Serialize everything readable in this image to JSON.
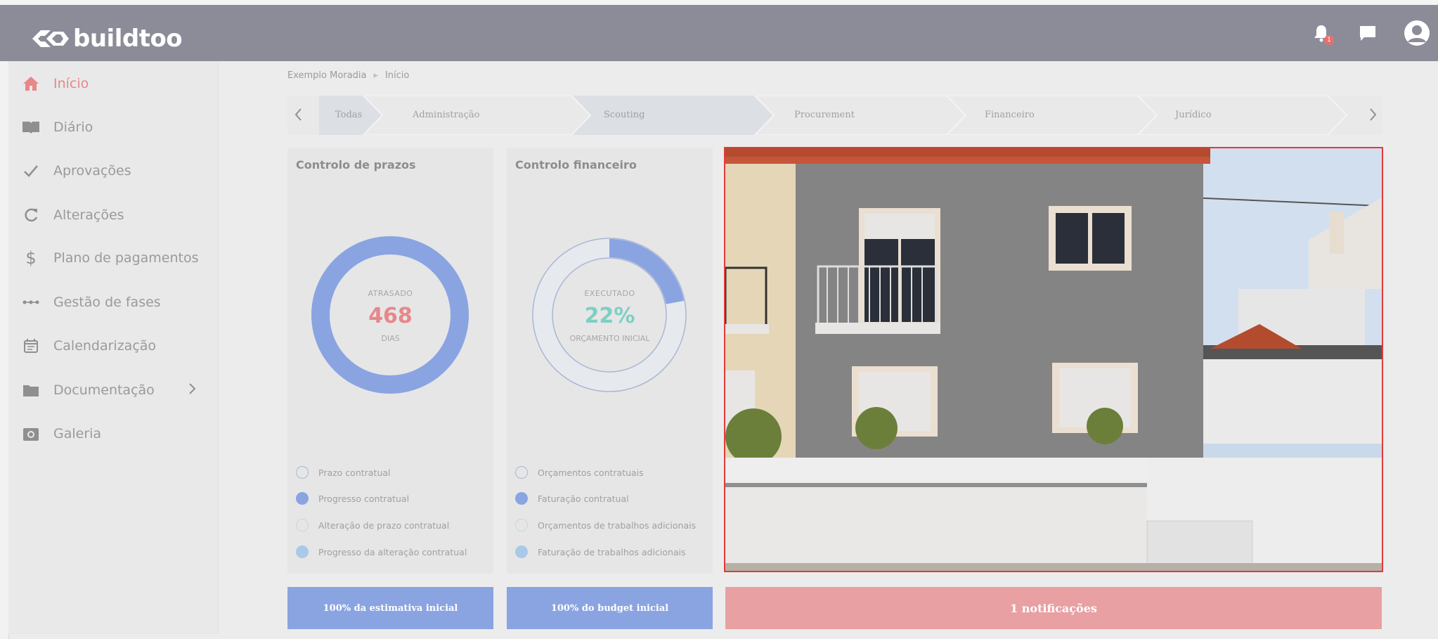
{
  "app": {
    "logo_text": "buildtoo",
    "notification_count": "1"
  },
  "sidebar": {
    "items": [
      {
        "label": "Início",
        "icon": "home-icon"
      },
      {
        "label": "Diário",
        "icon": "book-icon"
      },
      {
        "label": "Aprovações",
        "icon": "check-icon"
      },
      {
        "label": "Alterações",
        "icon": "refresh-icon"
      },
      {
        "label": "Plano de pagamentos",
        "icon": "dollar-icon"
      },
      {
        "label": "Gestão de fases",
        "icon": "phases-icon"
      },
      {
        "label": "Calendarização",
        "icon": "calendar-icon"
      },
      {
        "label": "Documentação",
        "icon": "folder-icon"
      },
      {
        "label": "Galeria",
        "icon": "camera-icon"
      }
    ]
  },
  "breadcrumb": {
    "project": "Exemplo Moradia",
    "current": "Início"
  },
  "phases": {
    "items": [
      "Todas",
      "Administração",
      "Scouting",
      "Procurement",
      "Financeiro",
      "Jurídico"
    ]
  },
  "deadlines": {
    "title": "Controlo de prazos",
    "center_top": "ATRASADO",
    "center_value": "468",
    "center_bottom": "DIAS",
    "progress_fraction": 1.0,
    "legend": [
      "Prazo contratual",
      "Progresso contratual",
      "Alteração de prazo contratual",
      "Progresso da alteração contratual"
    ],
    "footer": "100% da estimativa inicial"
  },
  "finance": {
    "title": "Controlo financeiro",
    "center_top": "EXECUTADO",
    "center_value": "22%",
    "center_bottom": "ORÇAMENTO INICIAL",
    "progress_fraction": 0.22,
    "legend": [
      "Orçamentos contratuais",
      "Faturação contratual",
      "Orçamentos de trabalhos adicionais",
      "Faturação de trabalhos adicionais"
    ],
    "footer": "100% do budget inicial"
  },
  "notifications": {
    "label": "1 notificações"
  },
  "colors": {
    "accent_blue": "#8aa4e2",
    "accent_red": "#e8a0a2",
    "active_text": "#e8878a",
    "finance_value": "#7ecfc4",
    "deadline_value": "#e8878a"
  }
}
